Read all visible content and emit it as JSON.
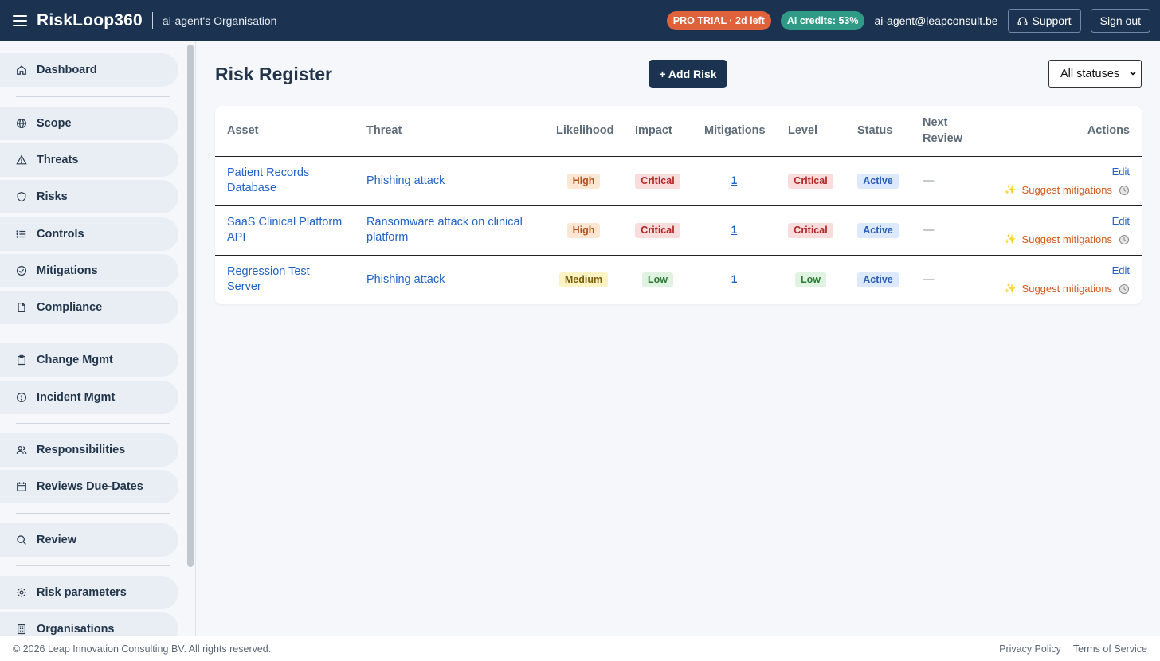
{
  "header": {
    "brand": "RiskLoop360",
    "org": "ai-agent's Organisation",
    "trial_badge": "PRO TRIAL · 2d left",
    "credits_badge": "AI credits: 53%",
    "user_email": "ai-agent@leapconsult.be",
    "support_label": "Support",
    "signout_label": "Sign out"
  },
  "sidebar": {
    "items": [
      {
        "label": "Dashboard",
        "icon": "home-icon"
      },
      {
        "label": "Scope",
        "icon": "globe-icon"
      },
      {
        "label": "Threats",
        "icon": "warning-triangle-icon"
      },
      {
        "label": "Risks",
        "icon": "shield-icon"
      },
      {
        "label": "Controls",
        "icon": "list-icon"
      },
      {
        "label": "Mitigations",
        "icon": "check-circle-icon"
      },
      {
        "label": "Compliance",
        "icon": "document-icon"
      },
      {
        "label": "Change Mgmt",
        "icon": "clipboard-icon"
      },
      {
        "label": "Incident Mgmt",
        "icon": "alert-circle-icon"
      },
      {
        "label": "Responsibilities",
        "icon": "users-icon"
      },
      {
        "label": "Reviews Due-Dates",
        "icon": "calendar-icon"
      },
      {
        "label": "Review",
        "icon": "search-icon"
      },
      {
        "label": "Risk parameters",
        "icon": "gear-icon"
      },
      {
        "label": "Organisations",
        "icon": "building-icon"
      }
    ]
  },
  "main": {
    "title": "Risk Register",
    "add_label": "+ Add Risk",
    "status_filter": "All statuses",
    "columns": [
      "Asset",
      "Threat",
      "Likelihood",
      "Impact",
      "Mitigations",
      "Level",
      "Status",
      "Next Review",
      "Actions"
    ],
    "rows": [
      {
        "asset": "Patient Records Database",
        "threat": "Phishing attack",
        "likelihood": "High",
        "impact": "Critical",
        "mitigations": "1",
        "level": "Critical",
        "status": "Active",
        "next_review": "—",
        "edit": "Edit",
        "suggest": "Suggest mitigations"
      },
      {
        "asset": "SaaS Clinical Platform API",
        "threat": "Ransomware attack on clinical platform",
        "likelihood": "High",
        "impact": "Critical",
        "mitigations": "1",
        "level": "Critical",
        "status": "Active",
        "next_review": "—",
        "edit": "Edit",
        "suggest": "Suggest mitigations"
      },
      {
        "asset": "Regression Test Server",
        "threat": "Phishing attack",
        "likelihood": "Medium",
        "impact": "Low",
        "mitigations": "1",
        "level": "Low",
        "status": "Active",
        "next_review": "—",
        "edit": "Edit",
        "suggest": "Suggest mitigations"
      }
    ]
  },
  "footer": {
    "copyright": "© 2026 Leap Innovation Consulting BV. All rights reserved.",
    "privacy": "Privacy Policy",
    "terms": "Terms of Service"
  }
}
